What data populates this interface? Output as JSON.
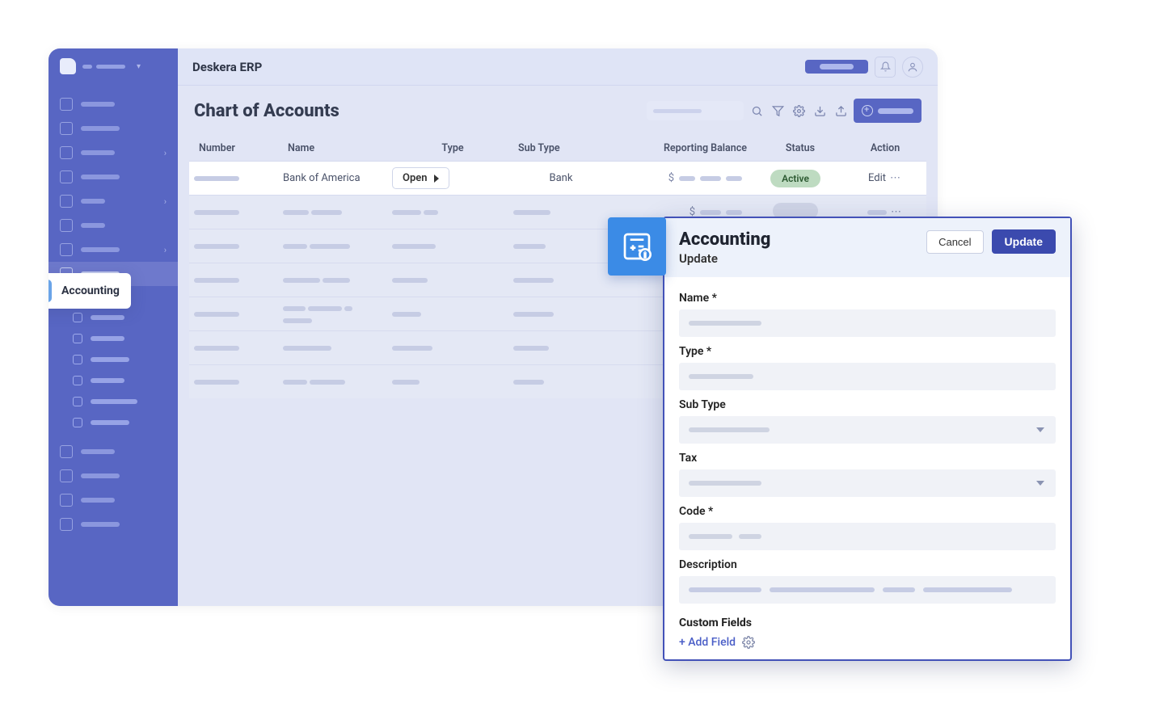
{
  "topbar": {
    "title": "Deskera ERP"
  },
  "page": {
    "title": "Chart of Accounts"
  },
  "accountingTag": "Accounting",
  "table": {
    "columns": {
      "number": "Number",
      "name": "Name",
      "type": "Type",
      "subType": "Sub Type",
      "balance": "Reporting Balance",
      "status": "Status",
      "action": "Action"
    },
    "row0": {
      "name": "Bank of America",
      "typePill": "Open",
      "subType": "Bank",
      "currency": "$",
      "status": "Active",
      "action": "Edit"
    },
    "currency": "$"
  },
  "panel": {
    "title": "Accounting",
    "subtitle": "Update",
    "cancel": "Cancel",
    "update": "Update",
    "fields": {
      "name": "Name *",
      "type": "Type *",
      "subType": "Sub Type",
      "tax": "Tax",
      "code": "Code *",
      "description": "Description",
      "custom": "Custom Fields",
      "addField": "+ Add Field"
    }
  }
}
